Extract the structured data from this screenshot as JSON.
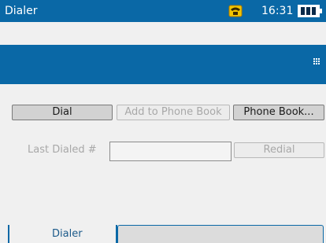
{
  "window": {
    "title": "Dialer",
    "time": "16:31"
  },
  "colors": {
    "accent": "#0a68a6",
    "indicator_phone": "#f2c500"
  },
  "icons": {
    "status_phone": "phone-icon",
    "battery": "battery-icon",
    "toolbar_keypad": "keypad-icon"
  },
  "actions": {
    "dial": "Dial",
    "add_to_phone_book": "Add to Phone Book",
    "phone_book": "Phone Book..."
  },
  "last_dialed": {
    "label": "Last Dialed #",
    "value": "",
    "redial": "Redial"
  },
  "tabs": [
    {
      "label": "Dialer"
    }
  ]
}
